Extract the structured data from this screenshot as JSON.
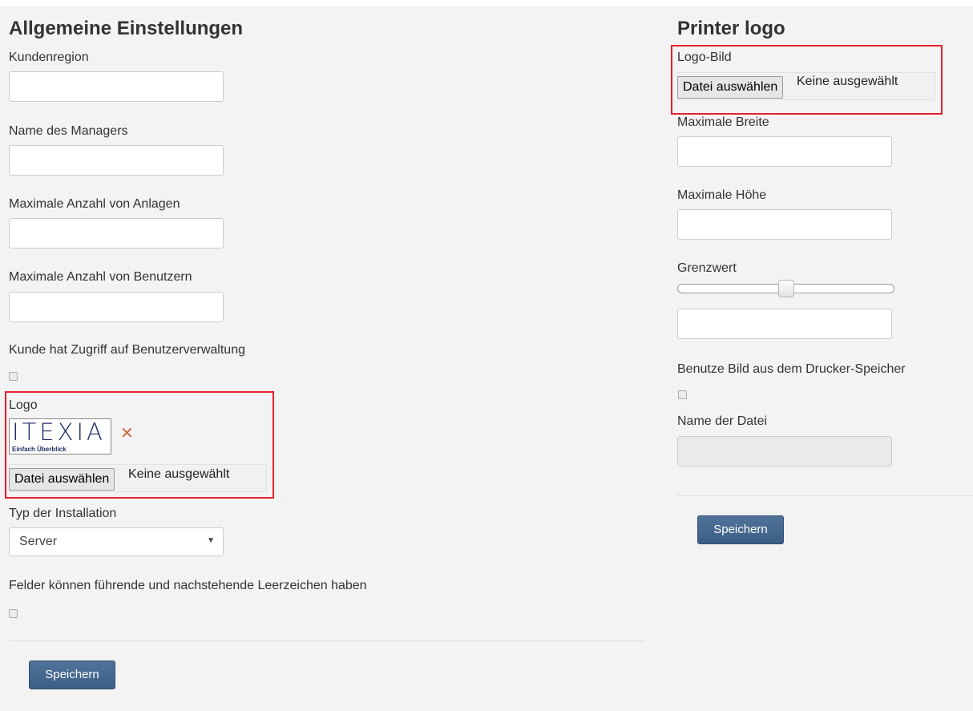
{
  "general": {
    "title": "Allgemeine Einstellungen",
    "customer_region_label": "Kundenregion",
    "customer_region_value": "",
    "manager_name_label": "Name des Managers",
    "manager_name_value": "",
    "max_devices_label": "Maximale Anzahl von Anlagen",
    "max_devices_value": "",
    "max_users_label": "Maximale Anzahl von Benutzern",
    "max_users_value": "",
    "user_admin_access_label": "Kunde hat Zugriff auf Benutzerverwaltung",
    "user_admin_access_checked": false,
    "logo_label": "Logo",
    "logo_image_text": "ITEXIA",
    "logo_image_tagline": "Einfach Überblick",
    "remove_logo_icon": "close-icon",
    "file_button_label": "Datei auswählen",
    "file_status": "Keine ausgewählt",
    "installation_type_label": "Typ der Installation",
    "installation_type_value": "Server",
    "trim_fields_label": "Felder können führende und nachstehende Leerzeichen haben",
    "trim_fields_checked": false,
    "save_label": "Speichern"
  },
  "printer_logo": {
    "title": "Printer logo",
    "logo_image_label": "Logo-Bild",
    "file_button_label": "Datei auswählen",
    "file_status": "Keine ausgewählt",
    "max_width_label": "Maximale Breite",
    "max_width_value": "",
    "max_height_label": "Maximale Höhe",
    "max_height_value": "",
    "threshold_label": "Grenzwert",
    "threshold_slider_fraction": 0.5,
    "threshold_value": "",
    "use_printer_memory_label": "Benutze Bild aus dem Drucker-Speicher",
    "use_printer_memory_checked": false,
    "filename_label": "Name der Datei",
    "filename_value": "",
    "save_label": "Speichern"
  },
  "colors": {
    "primary_button": "#3f6289",
    "highlight_border": "#e5202a",
    "background": "#f3f3f3"
  }
}
